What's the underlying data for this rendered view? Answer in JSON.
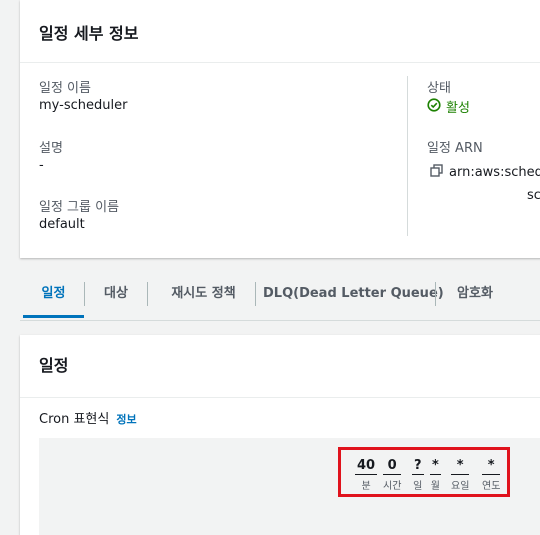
{
  "details": {
    "title": "일정 세부 정보",
    "schedule_name_label": "일정 이름",
    "schedule_name": "my-scheduler",
    "description_label": "설명",
    "description": "-",
    "group_label": "일정 그룹 이름",
    "group": "default",
    "status_label": "상태",
    "status": "활성",
    "arn_label": "일정 ARN",
    "arn_line1": "arn:aws:schedul",
    "arn_line2": "sc"
  },
  "tabs": [
    "일정",
    "대상",
    "재시도 정책",
    "DLQ(Dead Letter Queue)",
    "암호화"
  ],
  "schedule": {
    "title": "일정",
    "cron_label": "Cron 표현식",
    "info_link": "정보",
    "fields": [
      {
        "value": "40",
        "label": "분"
      },
      {
        "value": "0",
        "label": "시간"
      },
      {
        "value": "?",
        "label": "일"
      },
      {
        "value": "*",
        "label": "월"
      },
      {
        "value": "*",
        "label": "요일"
      },
      {
        "value": "*",
        "label": "연도"
      }
    ]
  },
  "colors": {
    "link": "#0073bb",
    "success": "#1d8102",
    "highlight": "#e0121c"
  }
}
